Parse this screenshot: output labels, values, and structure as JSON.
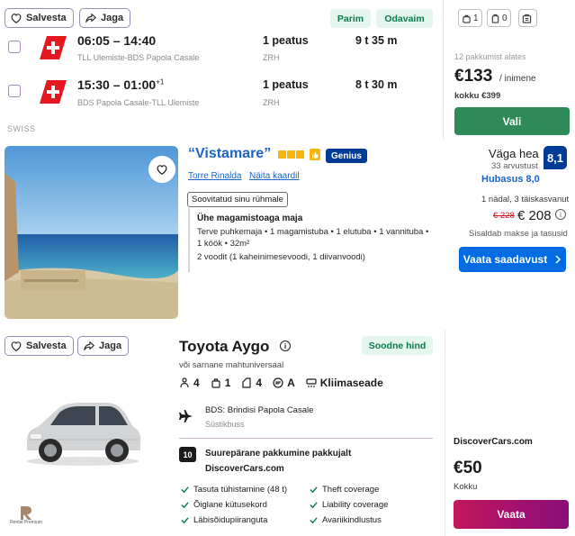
{
  "flight": {
    "save_label": "Salvesta",
    "share_label": "Jaga",
    "tags": [
      "Parim",
      "Odavaim"
    ],
    "legs": [
      {
        "times": "06:05 – 14:40",
        "day_offset": "",
        "route": "TLL Ulemiste-BDS Papola Casale",
        "stops": "1 peatus",
        "via": "ZRH",
        "duration": "9 t 35 m"
      },
      {
        "times": "15:30 – 01:00",
        "day_offset": "+1",
        "route": "BDS Papola Casale-TLL Ulemiste",
        "stops": "1 peatus",
        "via": "ZRH",
        "duration": "8 t 30 m"
      }
    ],
    "carrier": "SWISS",
    "bags": [
      {
        "icon": "personal-bag-icon",
        "count": "1"
      },
      {
        "icon": "carry-on-icon",
        "count": "0"
      },
      {
        "icon": "checked-bag-icon",
        "count": ""
      }
    ],
    "deals": "12 pakkumist alates",
    "price": "€133",
    "price_per": "/ inimene",
    "price_total": "kokku €399",
    "select_label": "Vali"
  },
  "hotel": {
    "name": "“Vistamare”",
    "genius": "Genius",
    "links": [
      "Torre Rinalda",
      "Näita kaardil"
    ],
    "suggest": "Soovitatud sinu rühmale",
    "room_title": "Ühe magamistoaga maja",
    "room_lines": [
      "Terve puhkemaja • 1 magamistuba • 1 elutuba • 1 vannituba •",
      "1 köök • 32m²",
      "2 voodit (1 kaheinimesevoodi, 1 diivanvoodi)"
    ],
    "rating_word": "Väga hea",
    "rating_count": "33 arvustust",
    "score": "8,1",
    "location_score": "Hubasus 8,0",
    "stay_info": "1 nädal, 3 täiskasvanut",
    "old_price": "€ 228",
    "new_price": "€ 208",
    "taxes": "Sisaldab makse ja tasusid",
    "avail_label": "Vaata saadavust"
  },
  "car": {
    "save_label": "Salvesta",
    "share_label": "Jaga",
    "title": "Toyota Aygo",
    "good_price": "Soodne hind",
    "subtitle": "või sarnane mahtuniversaal",
    "specs": [
      {
        "icon": "seats-icon",
        "value": "4"
      },
      {
        "icon": "bag-icon",
        "value": "1"
      },
      {
        "icon": "doors-icon",
        "value": "4"
      },
      {
        "icon": "transmission-icon",
        "value": "A"
      },
      {
        "icon": "ac-icon",
        "value": "Kliimaseade"
      }
    ],
    "pickup_name": "BDS: Brindisi Papola Casale",
    "pickup_type": "Süstikbuss",
    "supplier_score": "10",
    "supplier_line1": "Suurepärane pakkumine pakkujalt",
    "supplier_line2": "DiscoverCars.com",
    "features_left": [
      "Tasuta tühistamine (48 t)",
      "Õiglane kütusekord",
      "Läbisõidupiiranguta"
    ],
    "features_right": [
      "Theft coverage",
      "Liability coverage",
      "Avariikindlustus"
    ],
    "brand": "DiscoverCars.com",
    "price": "€50",
    "price_label": "Kokku",
    "view_label": "Vaata",
    "supplier_logo_text": "Rental Premium"
  }
}
